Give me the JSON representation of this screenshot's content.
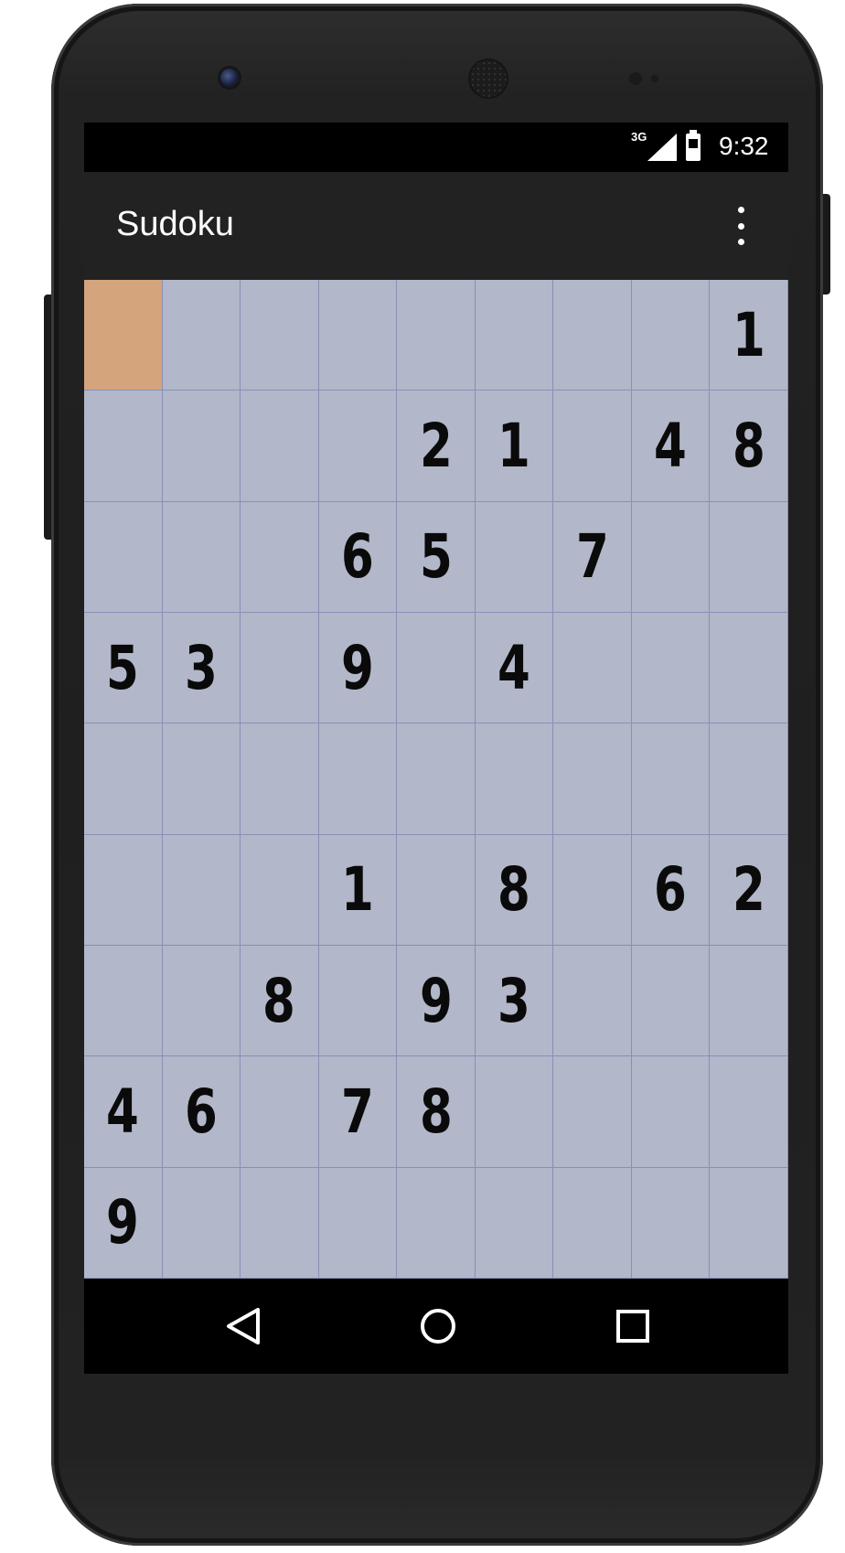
{
  "status_bar": {
    "network": "3G",
    "time": "9:32"
  },
  "app_bar": {
    "title": "Sudoku",
    "menu_icon": "overflow-menu-icon"
  },
  "board": {
    "selected": {
      "row": 0,
      "col": 0
    },
    "cells": [
      [
        "",
        "",
        "",
        "",
        "",
        "",
        "",
        "",
        "1"
      ],
      [
        "",
        "",
        "",
        "",
        "2",
        "1",
        "",
        "4",
        "8"
      ],
      [
        "",
        "",
        "",
        "6",
        "5",
        "",
        "7",
        "",
        ""
      ],
      [
        "5",
        "3",
        "",
        "9",
        "",
        "4",
        "",
        "",
        ""
      ],
      [
        "",
        "",
        "",
        "",
        "",
        "",
        "",
        "",
        ""
      ],
      [
        "",
        "",
        "",
        "1",
        "",
        "8",
        "",
        "6",
        "2"
      ],
      [
        "",
        "",
        "8",
        "",
        "9",
        "3",
        "",
        "",
        ""
      ],
      [
        "4",
        "6",
        "",
        "7",
        "8",
        "",
        "",
        "",
        ""
      ],
      [
        "9",
        "",
        "",
        "",
        "",
        "",
        "",
        "",
        ""
      ]
    ],
    "colors": {
      "background": "#b2b7c9",
      "selected": "#d4a47c",
      "grid": "#8a8fb6"
    }
  },
  "nav_bar": {
    "icons": [
      "back-icon",
      "home-icon",
      "recent-apps-icon"
    ]
  }
}
